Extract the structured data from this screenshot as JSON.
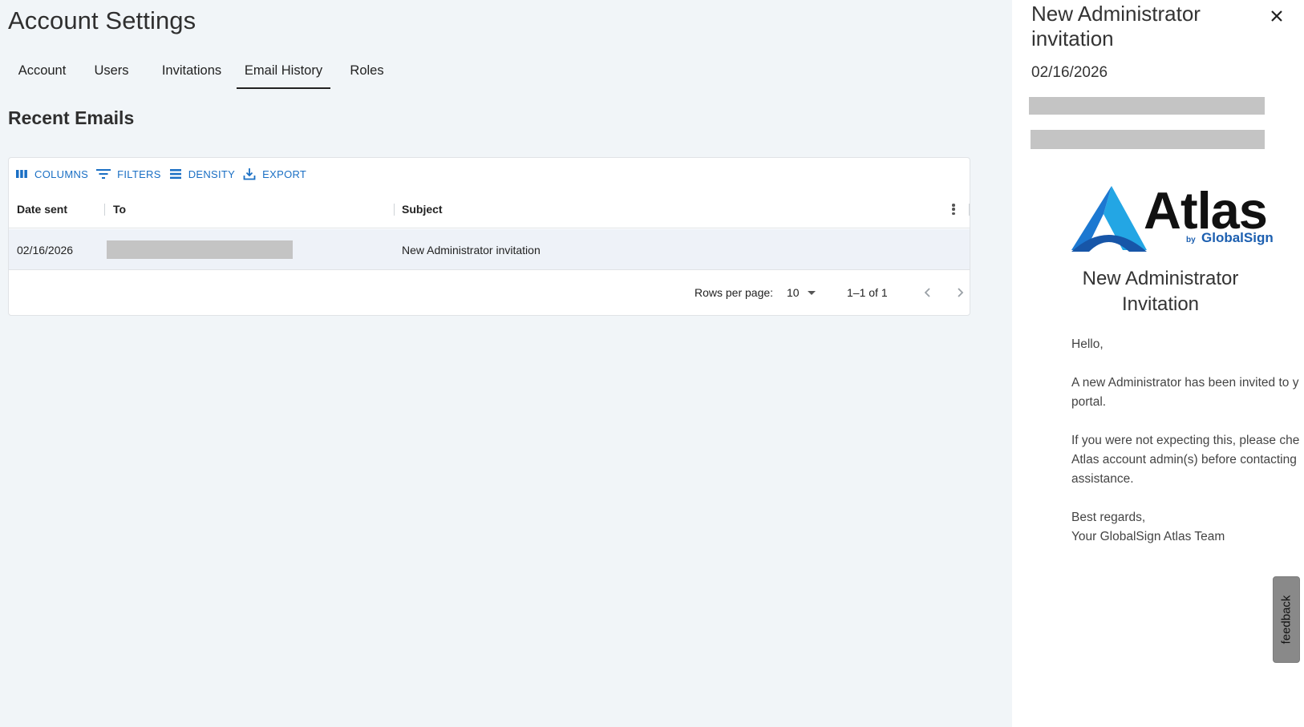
{
  "page": {
    "title": "Account Settings",
    "section_title": "Recent Emails"
  },
  "tabs": [
    {
      "label": "Account",
      "active": false
    },
    {
      "label": "Users",
      "active": false
    },
    {
      "label": "Invitations",
      "active": false
    },
    {
      "label": "Email History",
      "active": true
    },
    {
      "label": "Roles",
      "active": false
    }
  ],
  "toolbar": {
    "columns_label": "COLUMNS",
    "filters_label": "FILTERS",
    "density_label": "DENSITY",
    "export_label": "EXPORT"
  },
  "table": {
    "columns": [
      "Date sent",
      "To",
      "Subject"
    ],
    "rows": [
      {
        "date_sent": "02/16/2026",
        "to": "",
        "subject": "New Administrator invitation"
      }
    ]
  },
  "pagination": {
    "rows_per_page_label": "Rows per page:",
    "rows_per_page_value": "10",
    "range_text": "1–1 of 1"
  },
  "drawer": {
    "title": "New Administrator invitation",
    "date": "02/16/2026",
    "logo": {
      "word": "Atlas",
      "by": "by",
      "brand": "GlobalSign"
    },
    "email_heading": "New Administrator Invitation",
    "body": {
      "greeting": "Hello,",
      "para1_line1": "A new Administrator has been invited to y",
      "para1_line2": "portal.",
      "para2_line1": "If you were not expecting this, please che",
      "para2_line2": "Atlas account admin(s) before contacting",
      "para2_line3": "assistance.",
      "closing_line1": "Best regards,",
      "closing_line2": "Your GlobalSign Atlas Team"
    }
  },
  "feedback_label": "feedback",
  "colors": {
    "background": "#f1f5f8",
    "accent": "#1a6fc4",
    "row_highlight": "#eef2f8",
    "redaction": "#c4c4c4",
    "logo_blue": "#1c5fb0",
    "logo_light_blue": "#23a6e4"
  }
}
